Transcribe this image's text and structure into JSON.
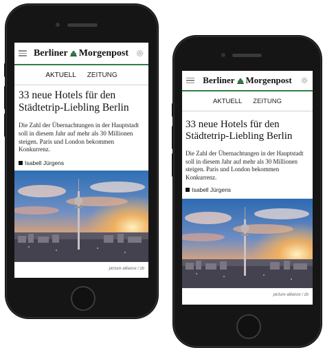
{
  "brand": {
    "name_left": "Berliner",
    "name_right": "Morgenpost",
    "accent_color": "#2f7d46"
  },
  "nav": {
    "tabs": [
      {
        "label": "AKTUELL",
        "active": true
      },
      {
        "label": "ZEITUNG",
        "active": false
      }
    ]
  },
  "article": {
    "headline_line1": "33 neue Hotels für den",
    "headline_line2": "Städtetrip-Liebling Berlin",
    "teaser": "Die Zahl der Übernachtungen in der Hauptstadt soll in diesem Jahr auf mehr als 30 Millionen steigen. Paris und London bekommen Konkurrenz.",
    "author": "Isabell Jürgens",
    "image_credit": "picture alliance / zb"
  },
  "icons": {
    "menu": "hamburger-menu-icon",
    "settings": "gear-icon",
    "logo": "bear-crest-icon"
  }
}
